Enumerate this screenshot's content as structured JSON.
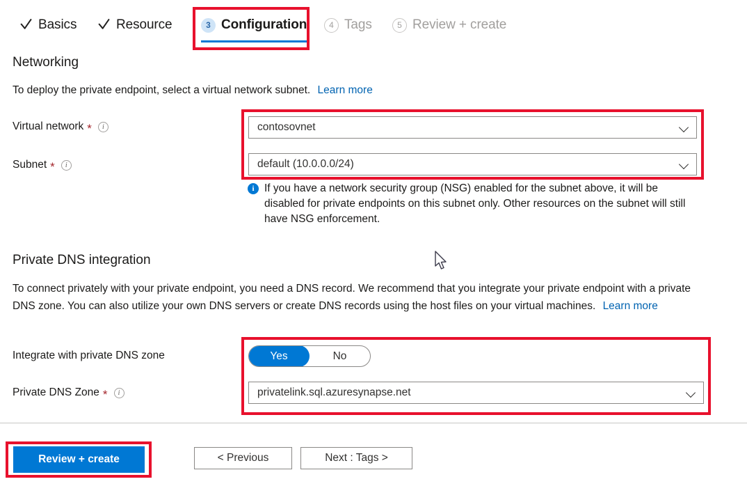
{
  "wizard": {
    "tabs": [
      {
        "label": "Basics",
        "state": "done",
        "icon": "check-icon"
      },
      {
        "label": "Resource",
        "state": "done",
        "icon": "check-icon"
      },
      {
        "label": "Configuration",
        "state": "current",
        "number": "3"
      },
      {
        "label": "Tags",
        "state": "todo",
        "number": "4"
      },
      {
        "label": "Review + create",
        "state": "todo",
        "number": "5"
      }
    ]
  },
  "networking": {
    "heading": "Networking",
    "description": "To deploy the private endpoint, select a virtual network subnet.",
    "learn_more": "Learn more",
    "virtual_network": {
      "label": "Virtual network",
      "required_mark": "*",
      "value": "contosovnet"
    },
    "subnet": {
      "label": "Subnet",
      "required_mark": "*",
      "value": "default (10.0.0.0/24)"
    },
    "nsg_info": "If you have a network security group (NSG) enabled for the subnet above, it will be disabled for private endpoints on this subnet only. Other resources on the subnet will still have NSG enforcement."
  },
  "private_dns": {
    "heading": "Private DNS integration",
    "description": "To connect privately with your private endpoint, you need a DNS record. We recommend that you integrate your private endpoint with a private DNS zone. You can also utilize your own DNS servers or create DNS records using the host files on your virtual machines.",
    "learn_more": "Learn more",
    "integrate_toggle": {
      "label": "Integrate with private DNS zone",
      "yes_label": "Yes",
      "no_label": "No",
      "selected": "Yes"
    },
    "zone": {
      "label": "Private DNS Zone",
      "required_mark": "*",
      "value": "privatelink.sql.azuresynapse.net"
    }
  },
  "footer": {
    "review_create": "Review + create",
    "previous": "< Previous",
    "next": "Next : Tags >"
  },
  "colors": {
    "accent_blue": "#0078d4",
    "link_blue": "#0063b1",
    "annotation_red": "#e8112d",
    "required_red": "#a4262c",
    "badge_bg": "#cfe4f7",
    "badge_text": "#2a67a8"
  }
}
